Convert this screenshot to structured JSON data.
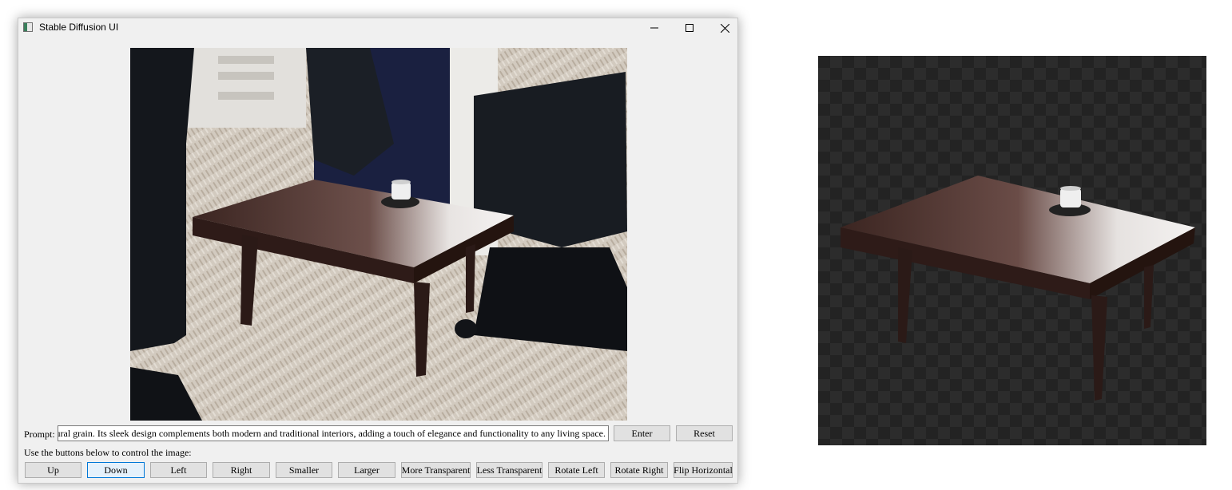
{
  "window": {
    "title": "Stable Diffusion UI"
  },
  "prompt": {
    "label": "Prompt:",
    "value": "ng its natural grain. Its sleek design complements both modern and traditional interiors, adding a touch of elegance and functionality to any living space.",
    "enter_label": "Enter",
    "reset_label": "Reset"
  },
  "controls": {
    "hint": "Use the buttons below to control the image:",
    "buttons": [
      "Up",
      "Down",
      "Left",
      "Right",
      "Smaller",
      "Larger",
      "More Transparent",
      "Less Transparent",
      "Rotate Left",
      "Rotate Right",
      "Flip Horizontal"
    ],
    "focused_button": "Down"
  },
  "colors": {
    "window_bg": "#f0f0f0",
    "button_bg": "#e1e1e1",
    "focus_border": "#0078d7",
    "table_wood": "#3a2320",
    "floor": "#c9bfb3"
  }
}
